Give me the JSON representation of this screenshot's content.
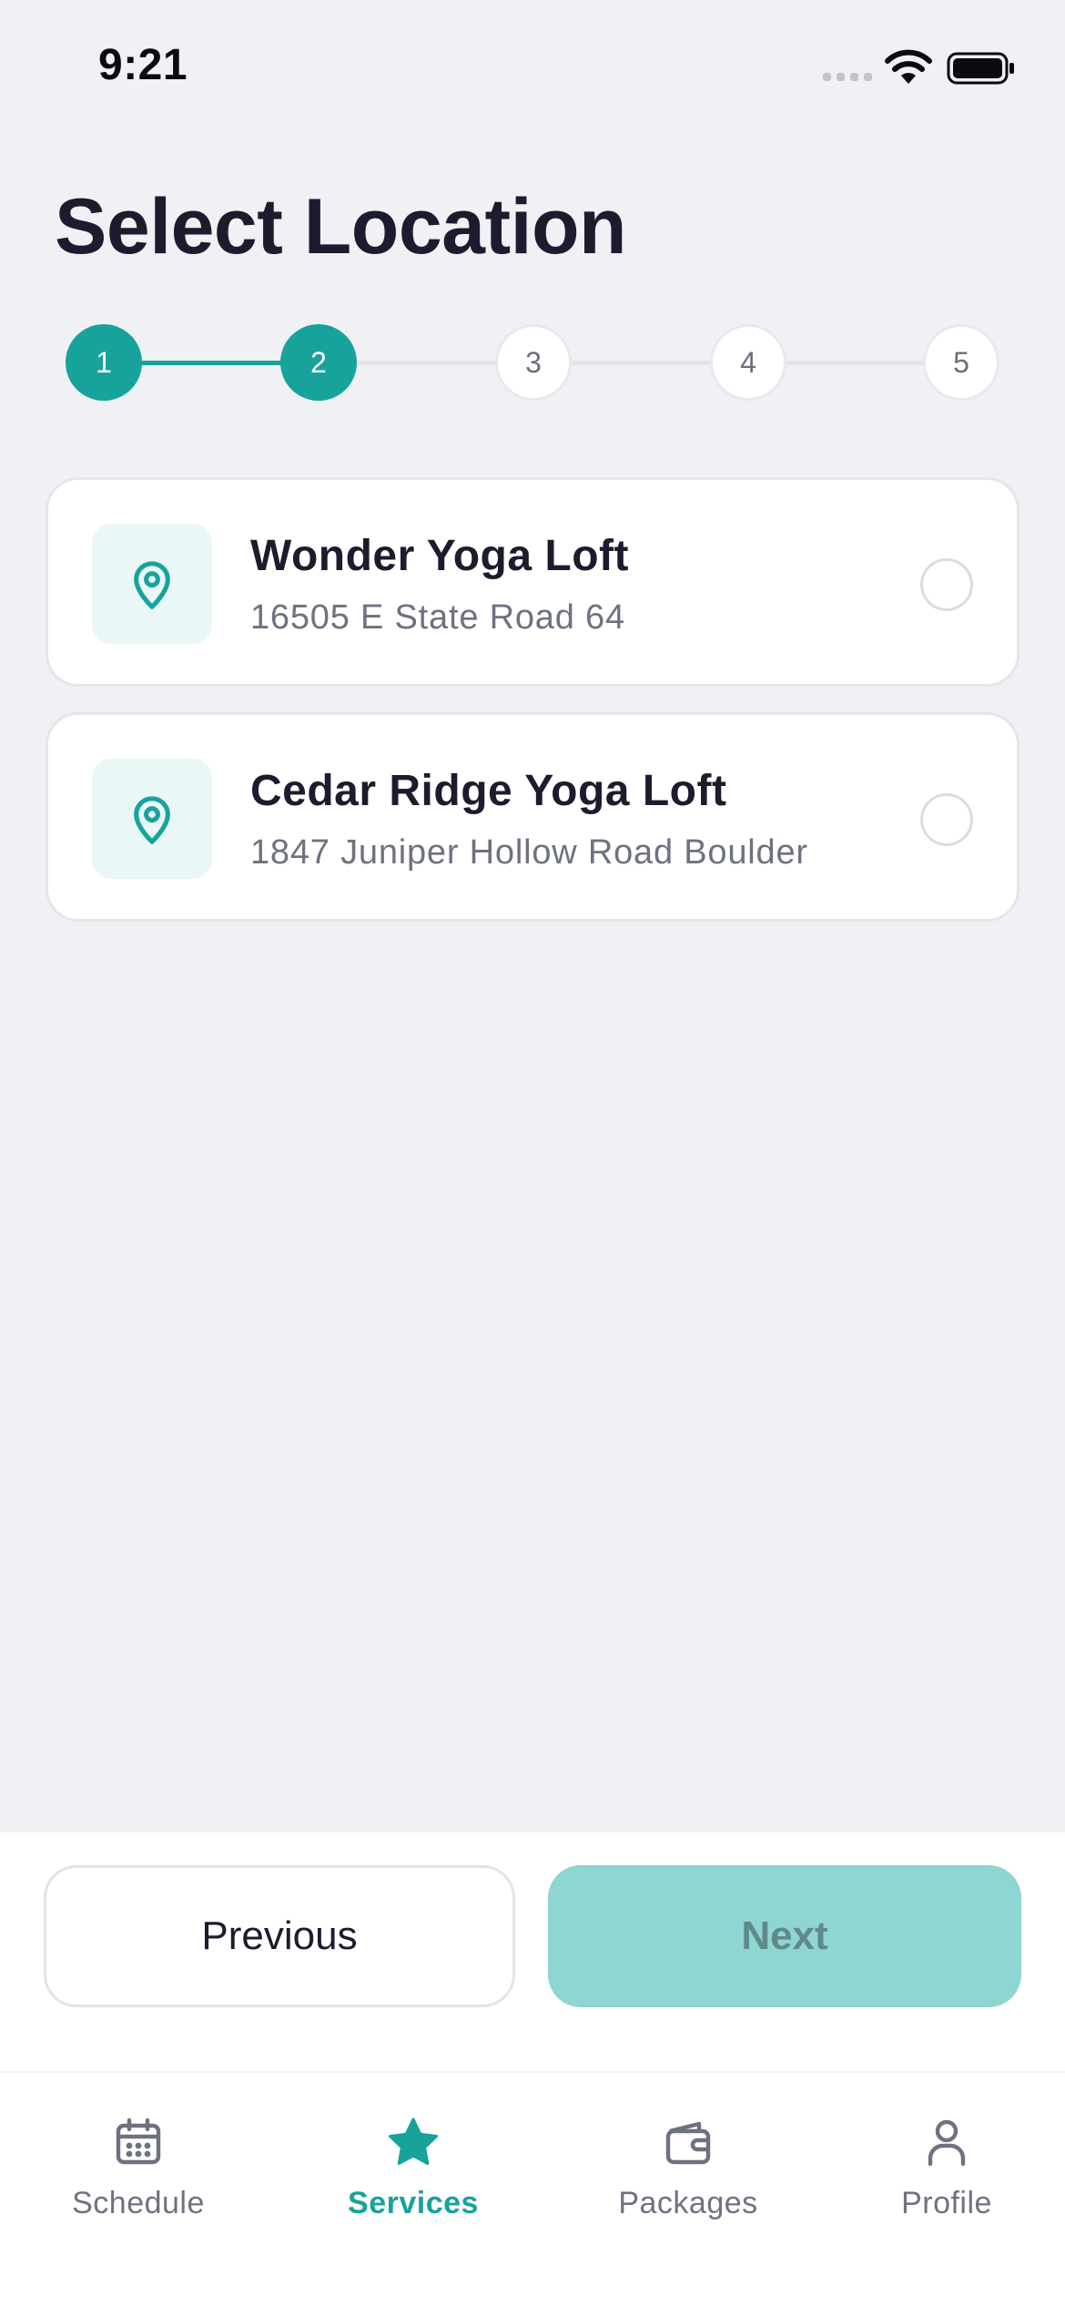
{
  "status_bar": {
    "time": "9:21"
  },
  "page": {
    "title": "Select Location"
  },
  "stepper": {
    "steps": [
      {
        "label": "1",
        "state": "complete"
      },
      {
        "label": "2",
        "state": "current"
      },
      {
        "label": "3",
        "state": "pending"
      },
      {
        "label": "4",
        "state": "pending"
      },
      {
        "label": "5",
        "state": "pending"
      }
    ]
  },
  "locations": [
    {
      "name": "Wonder Yoga Loft",
      "address": "16505 E State Road 64",
      "icon": "map-pin-icon",
      "selected": false
    },
    {
      "name": "Cedar Ridge Yoga Loft",
      "address": "1847 Juniper Hollow Road Boulder",
      "icon": "map-pin-icon",
      "selected": false
    }
  ],
  "actions": {
    "previous_label": "Previous",
    "next_label": "Next",
    "next_enabled": false
  },
  "tab_bar": {
    "tabs": [
      {
        "label": "Schedule",
        "icon": "calendar-icon",
        "active": false
      },
      {
        "label": "Services",
        "icon": "star-icon",
        "active": true
      },
      {
        "label": "Packages",
        "icon": "wallet-icon",
        "active": false
      },
      {
        "label": "Profile",
        "icon": "user-icon",
        "active": false
      }
    ]
  },
  "colors": {
    "accent": "#17a39c",
    "accent_disabled": "#8fd5d1",
    "background": "#eff1f5",
    "text_primary": "#1c1c2e",
    "text_secondary": "#6e7280"
  }
}
